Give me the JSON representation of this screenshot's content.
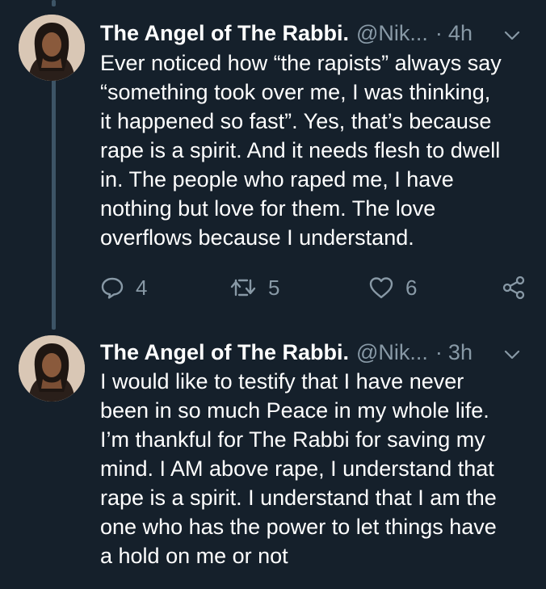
{
  "tweets": [
    {
      "display_name": "The Angel of The Rabbi.",
      "handle": "@Nik...",
      "separator": "·",
      "time": "4h",
      "text": "Ever noticed how “the rapists” always say\n“something took over me, I was thinking,\nit happened so fast”. Yes, that’s because\nrape is a spirit. And it needs flesh to dwell\nin. The people who raped me, I have\nnothing but love for them. The love\noverflows because I understand.",
      "reply_count": "4",
      "retweet_count": "5",
      "like_count": "6"
    },
    {
      "display_name": "The Angel of The Rabbi.",
      "handle": "@Nik...",
      "separator": "·",
      "time": "3h",
      "text": "I would like to testify that I have never\nbeen in so much Peace in my whole life.\nI’m thankful for The Rabbi for saving my\nmind. I AM above rape, I understand that\nrape is a spirit. I understand that I am the\none who has the power to let things have\na hold on me or not"
    }
  ],
  "icons": {
    "caret": "chevron-down-icon",
    "reply": "reply-icon",
    "retweet": "retweet-icon",
    "like": "heart-icon",
    "share": "share-icon"
  },
  "colors": {
    "background": "#15202b",
    "primary_text": "#ffffff",
    "secondary_text": "#8899a6",
    "thread_line": "#3d5466"
  }
}
